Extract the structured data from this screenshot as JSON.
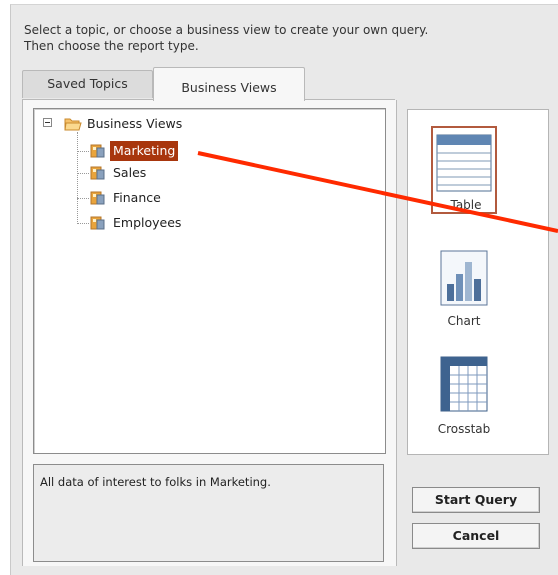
{
  "instructions": {
    "line1": "Select a topic, or choose a business view to create your own query.",
    "line2": "Then choose the report type."
  },
  "tabs": [
    {
      "label": "Saved Topics",
      "active": false
    },
    {
      "label": "Business Views",
      "active": true
    }
  ],
  "tree": {
    "root": {
      "label": "Business Views",
      "icon": "folder-open-icon",
      "expanded": true
    },
    "children": [
      {
        "label": "Marketing",
        "icon": "business-view-icon",
        "selected": true
      },
      {
        "label": "Sales",
        "icon": "business-view-icon",
        "selected": false
      },
      {
        "label": "Finance",
        "icon": "business-view-icon",
        "selected": false
      },
      {
        "label": "Employees",
        "icon": "business-view-icon",
        "selected": false
      }
    ]
  },
  "description": "All data of interest to folks in Marketing.",
  "report_types": [
    {
      "label": "Table",
      "icon": "table-icon",
      "selected": true
    },
    {
      "label": "Chart",
      "icon": "bar-chart-icon",
      "selected": false
    },
    {
      "label": "Crosstab",
      "icon": "crosstab-icon",
      "selected": false
    }
  ],
  "buttons": {
    "start_query": "Start Query",
    "cancel": "Cancel"
  },
  "colors": {
    "selection": "#a8360d",
    "annotation_arrow": "#ff2a00",
    "active_border": "#b25a3e"
  }
}
